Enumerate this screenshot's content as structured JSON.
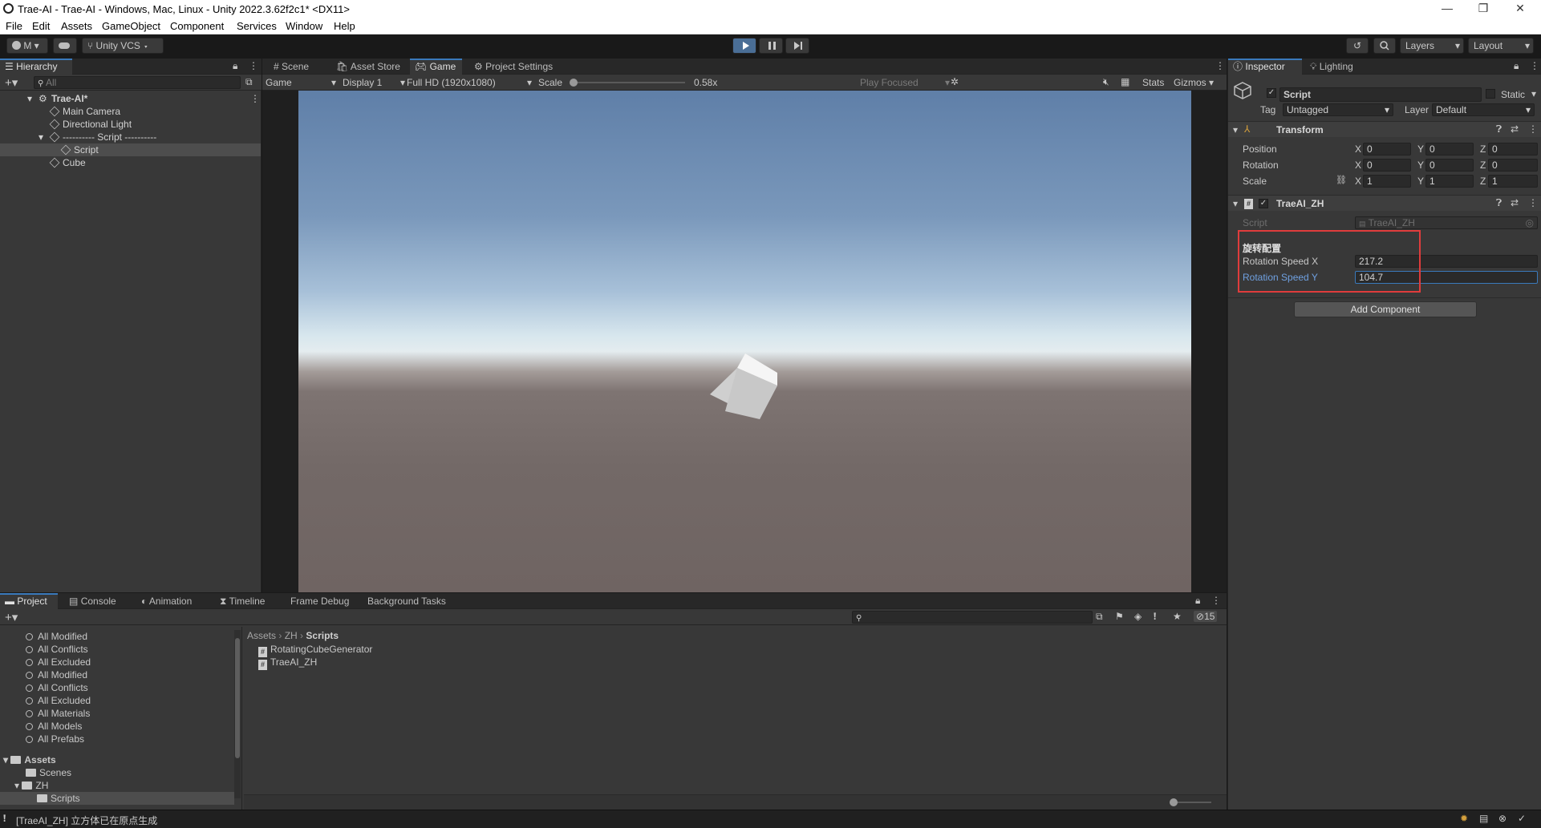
{
  "window": {
    "title": "Trae-AI - Trae-AI - Windows, Mac, Linux - Unity 2022.3.62f2c1* <DX11>",
    "minimize": "—",
    "maximize": "❐",
    "close": "✕"
  },
  "menu": [
    "File",
    "Edit",
    "Assets",
    "GameObject",
    "Component",
    "Services",
    "Window",
    "Help"
  ],
  "toolbar": {
    "account": "M",
    "vcs": "Unity VCS",
    "layers": "Layers",
    "layout": "Layout"
  },
  "hierarchy": {
    "tab": "Hierarchy",
    "search_placeholder": "All",
    "scene": "Trae-AI*",
    "items": [
      "Main Camera",
      "Directional Light",
      "---------- Script ----------",
      "Script",
      "Cube"
    ]
  },
  "views": {
    "tabs": [
      "Scene",
      "Asset Store",
      "Game",
      "Project Settings"
    ],
    "game_dropdown": "Game",
    "display": "Display 1",
    "resolution": "Full HD (1920x1080)",
    "scale_label": "Scale",
    "scale_value": "0.58x",
    "play_focused": "Play Focused",
    "stats": "Stats",
    "gizmos": "Gizmos"
  },
  "inspector": {
    "tabs": [
      "Inspector",
      "Lighting"
    ],
    "object_name": "Script",
    "static_label": "Static",
    "tag_label": "Tag",
    "tag_value": "Untagged",
    "layer_label": "Layer",
    "layer_value": "Default",
    "transform": {
      "title": "Transform",
      "position_label": "Position",
      "rotation_label": "Rotation",
      "scale_label": "Scale",
      "position": [
        "0",
        "0",
        "0"
      ],
      "rotation": [
        "0",
        "0",
        "0"
      ],
      "scale": [
        "1",
        "1",
        "1"
      ]
    },
    "axes": [
      "X",
      "Y",
      "Z"
    ],
    "script_component": {
      "title": "TraeAI_ZH",
      "script_label": "Script",
      "script_value": "TraeAI_ZH",
      "header": "旋转配置",
      "speed_x_label": "Rotation Speed X",
      "speed_x": "217.2",
      "speed_y_label": "Rotation Speed Y",
      "speed_y": "104.7"
    },
    "add_component": "Add Component"
  },
  "project": {
    "tabs": [
      "Project",
      "Console",
      "Animation",
      "Timeline",
      "Frame Debug",
      "Background Tasks"
    ],
    "favorites": [
      "All Modified",
      "All Conflicts",
      "All Excluded",
      "All Modified",
      "All Conflicts",
      "All Excluded",
      "All Materials",
      "All Models",
      "All Prefabs"
    ],
    "tree": {
      "assets": "Assets",
      "scenes": "Scenes",
      "zh": "ZH",
      "scripts": "Scripts"
    },
    "breadcrumb": [
      "Assets",
      "ZH",
      "Scripts"
    ],
    "files": [
      "RotatingCubeGenerator",
      "TraeAI_ZH"
    ],
    "hidden_count": "15"
  },
  "status": {
    "message": "[TraeAI_ZH] 立方体已在原点生成"
  },
  "colors": {
    "accent": "#3a79bb",
    "highlight_box": "#e03c3c",
    "play_active": "#4a6e96"
  }
}
